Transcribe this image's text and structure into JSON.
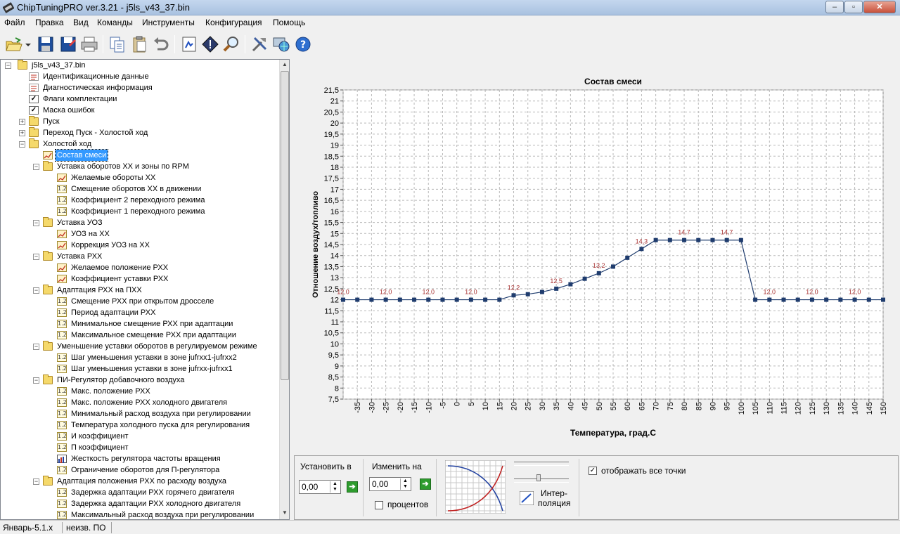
{
  "window": {
    "title": "ChipTuningPRO ver.3.21 - j5ls_v43_37.bin",
    "minimize_icon": "minimize-icon",
    "maximize_icon": "maximize-icon",
    "close_icon": "close-icon"
  },
  "menu": [
    "Файл",
    "Правка",
    "Вид",
    "Команды",
    "Инструменты",
    "Конфигурация",
    "Помощь"
  ],
  "toolbar": {
    "icons": [
      "open-icon",
      "dropdown-arrow-icon",
      "save-icon",
      "save-as-icon",
      "print-icon",
      "copy-icon",
      "paste-icon",
      "undo-icon",
      "file-compare-icon",
      "info-icon",
      "search-icon",
      "tools-icon",
      "globe-icon",
      "help-icon"
    ]
  },
  "tree": {
    "items": [
      {
        "label": "j5ls_v43_37.bin",
        "level": 0,
        "icon": "folder",
        "expander": "minus"
      },
      {
        "label": "Идентификационные данные",
        "level": 1,
        "icon": "doc"
      },
      {
        "label": "Диагностическая информация",
        "level": 1,
        "icon": "doc"
      },
      {
        "label": "Флаги комплектации",
        "level": 1,
        "icon": "check"
      },
      {
        "label": "Маска ошибок",
        "level": 1,
        "icon": "check"
      },
      {
        "label": "Пуск",
        "level": 1,
        "icon": "folder",
        "expander": "plus"
      },
      {
        "label": "Переход Пуск - Холостой ход",
        "level": 1,
        "icon": "folder",
        "expander": "plus"
      },
      {
        "label": "Холостой ход",
        "level": 1,
        "icon": "folder",
        "expander": "minus"
      },
      {
        "label": "Состав смеси",
        "level": 2,
        "icon": "graph",
        "selected": true
      },
      {
        "label": "Уставка оборотов ХХ и зоны по RPM",
        "level": 2,
        "icon": "folder",
        "expander": "minus"
      },
      {
        "label": "Желаемые обороты ХХ",
        "level": 3,
        "icon": "graph"
      },
      {
        "label": "Смещение оборотов ХХ в движении",
        "level": 3,
        "icon": "num"
      },
      {
        "label": "Коэффициент 2 переходного режима",
        "level": 3,
        "icon": "num"
      },
      {
        "label": "Коэффициент 1 переходного режима",
        "level": 3,
        "icon": "num"
      },
      {
        "label": "Уставка УОЗ",
        "level": 2,
        "icon": "folder",
        "expander": "minus"
      },
      {
        "label": "УОЗ на ХХ",
        "level": 3,
        "icon": "graph"
      },
      {
        "label": "Коррекция УОЗ на ХХ",
        "level": 3,
        "icon": "graph"
      },
      {
        "label": "Уставка РХХ",
        "level": 2,
        "icon": "folder",
        "expander": "minus"
      },
      {
        "label": "Желаемое положение РХХ",
        "level": 3,
        "icon": "graph"
      },
      {
        "label": "Коэффициент уставки РХХ",
        "level": 3,
        "icon": "graph"
      },
      {
        "label": "Адаптация РХХ на ПХХ",
        "level": 2,
        "icon": "folder",
        "expander": "minus"
      },
      {
        "label": "Смещение РХХ при открытом дросселе",
        "level": 3,
        "icon": "num"
      },
      {
        "label": "Период адаптации РХХ",
        "level": 3,
        "icon": "num"
      },
      {
        "label": "Минимальное смещение РХХ при адаптации",
        "level": 3,
        "icon": "num"
      },
      {
        "label": "Максимальное смещение РХХ при адаптации",
        "level": 3,
        "icon": "num"
      },
      {
        "label": "Уменьшение уставки оборотов в регулируемом режиме",
        "level": 2,
        "icon": "folder",
        "expander": "minus"
      },
      {
        "label": "Шаг уменьшения уставки в зоне jufrxx1-jufrxx2",
        "level": 3,
        "icon": "num"
      },
      {
        "label": "Шаг уменьшения уставки в зоне jufrxx-jufrxx1",
        "level": 3,
        "icon": "num"
      },
      {
        "label": "ПИ-Регулятор добавочного воздуха",
        "level": 2,
        "icon": "folder",
        "expander": "minus"
      },
      {
        "label": "Макс. положение РХХ",
        "level": 3,
        "icon": "num"
      },
      {
        "label": "Макс. положение РХХ холодного двигателя",
        "level": 3,
        "icon": "num"
      },
      {
        "label": "Минимальный расход воздуха при регулировании",
        "level": 3,
        "icon": "num"
      },
      {
        "label": "Температура холодного пуска для регулирования",
        "level": 3,
        "icon": "num"
      },
      {
        "label": "И коэффициент",
        "level": 3,
        "icon": "num"
      },
      {
        "label": "П коэффициент",
        "level": 3,
        "icon": "num"
      },
      {
        "label": "Жесткость регулятора частоты вращения",
        "level": 3,
        "icon": "bars"
      },
      {
        "label": "Ограничение оборотов для П-регулятора",
        "level": 3,
        "icon": "num"
      },
      {
        "label": "Адаптация положения РХХ по расходу воздуха",
        "level": 2,
        "icon": "folder",
        "expander": "minus"
      },
      {
        "label": "Задержка адаптации РХХ горячего двигателя",
        "level": 3,
        "icon": "num"
      },
      {
        "label": "Задержка адаптации РХХ холодного двигателя",
        "level": 3,
        "icon": "num"
      },
      {
        "label": "Максимальный расход воздуха при регулировании",
        "level": 3,
        "icon": "num"
      }
    ],
    "num_icon_text": "1.2"
  },
  "chart_data": {
    "type": "line",
    "title": "Состав смеси",
    "xlabel": "Температура, град.С",
    "ylabel": "Отношение воздух/топливо",
    "x": [
      -40,
      -35,
      -30,
      -25,
      -20,
      -15,
      -10,
      -5,
      0,
      5,
      10,
      15,
      20,
      25,
      30,
      35,
      40,
      45,
      50,
      55,
      60,
      65,
      70,
      75,
      80,
      85,
      90,
      95,
      100,
      105,
      110,
      115,
      120,
      125,
      130,
      135,
      140,
      145,
      150
    ],
    "x_tick_labels": [
      "-35",
      "-30",
      "-25",
      "-20",
      "-15",
      "-10",
      "-5",
      "0",
      "5",
      "10",
      "15",
      "20",
      "25",
      "30",
      "35",
      "40",
      "45",
      "50",
      "55",
      "60",
      "65",
      "70",
      "75",
      "80",
      "85",
      "90",
      "95",
      "100",
      "105",
      "110",
      "115",
      "120",
      "125",
      "130",
      "135",
      "140",
      "145",
      "150"
    ],
    "y": [
      12.0,
      12.0,
      12.0,
      12.0,
      12.0,
      12.0,
      12.0,
      12.0,
      12.0,
      12.0,
      12.0,
      12.0,
      12.2,
      12.25,
      12.35,
      12.5,
      12.7,
      12.95,
      13.2,
      13.5,
      13.9,
      14.3,
      14.7,
      14.7,
      14.7,
      14.7,
      14.7,
      14.7,
      14.7,
      12.0,
      12.0,
      12.0,
      12.0,
      12.0,
      12.0,
      12.0,
      12.0,
      12.0,
      12.0
    ],
    "y_ticks": [
      "7,5",
      "8",
      "8,5",
      "9",
      "9,5",
      "10",
      "10,5",
      "11",
      "11,5",
      "12",
      "12,5",
      "13",
      "13,5",
      "14",
      "14,5",
      "15",
      "15,5",
      "16",
      "16,5",
      "17",
      "17,5",
      "18",
      "18,5",
      "19",
      "19,5",
      "20",
      "20,5",
      "21",
      "21,5"
    ],
    "xlim": [
      -40,
      150
    ],
    "ylim": [
      7.5,
      21.5
    ],
    "data_labels": [
      {
        "x": -40,
        "text": "12,0"
      },
      {
        "x": -25,
        "text": "12,0"
      },
      {
        "x": -10,
        "text": "12,0"
      },
      {
        "x": 5,
        "text": "12,0"
      },
      {
        "x": 20,
        "text": "12,2"
      },
      {
        "x": 35,
        "text": "12,5"
      },
      {
        "x": 50,
        "text": "13,2"
      },
      {
        "x": 65,
        "text": "14,3"
      },
      {
        "x": 80,
        "text": "14,7"
      },
      {
        "x": 95,
        "text": "14,7"
      },
      {
        "x": 110,
        "text": "12,0"
      },
      {
        "x": 125,
        "text": "12,0"
      },
      {
        "x": 140,
        "text": "12,0"
      }
    ],
    "grid": true,
    "line_color": "#1f3c6e",
    "label_color": "#a83232"
  },
  "controls": {
    "set_label": "Установить в",
    "set_value": "0,00",
    "change_label": "Изменить на",
    "change_value": "0,00",
    "percent_label": "процентов",
    "percent_checked": false,
    "interp_label_1": "Интер-",
    "interp_label_2": "поляция",
    "show_all_label": "отображать все точки",
    "show_all_checked": true,
    "check_mark": "✓"
  },
  "status": {
    "left": "Январь-5.1.x",
    "right": "неизв. ПО"
  }
}
